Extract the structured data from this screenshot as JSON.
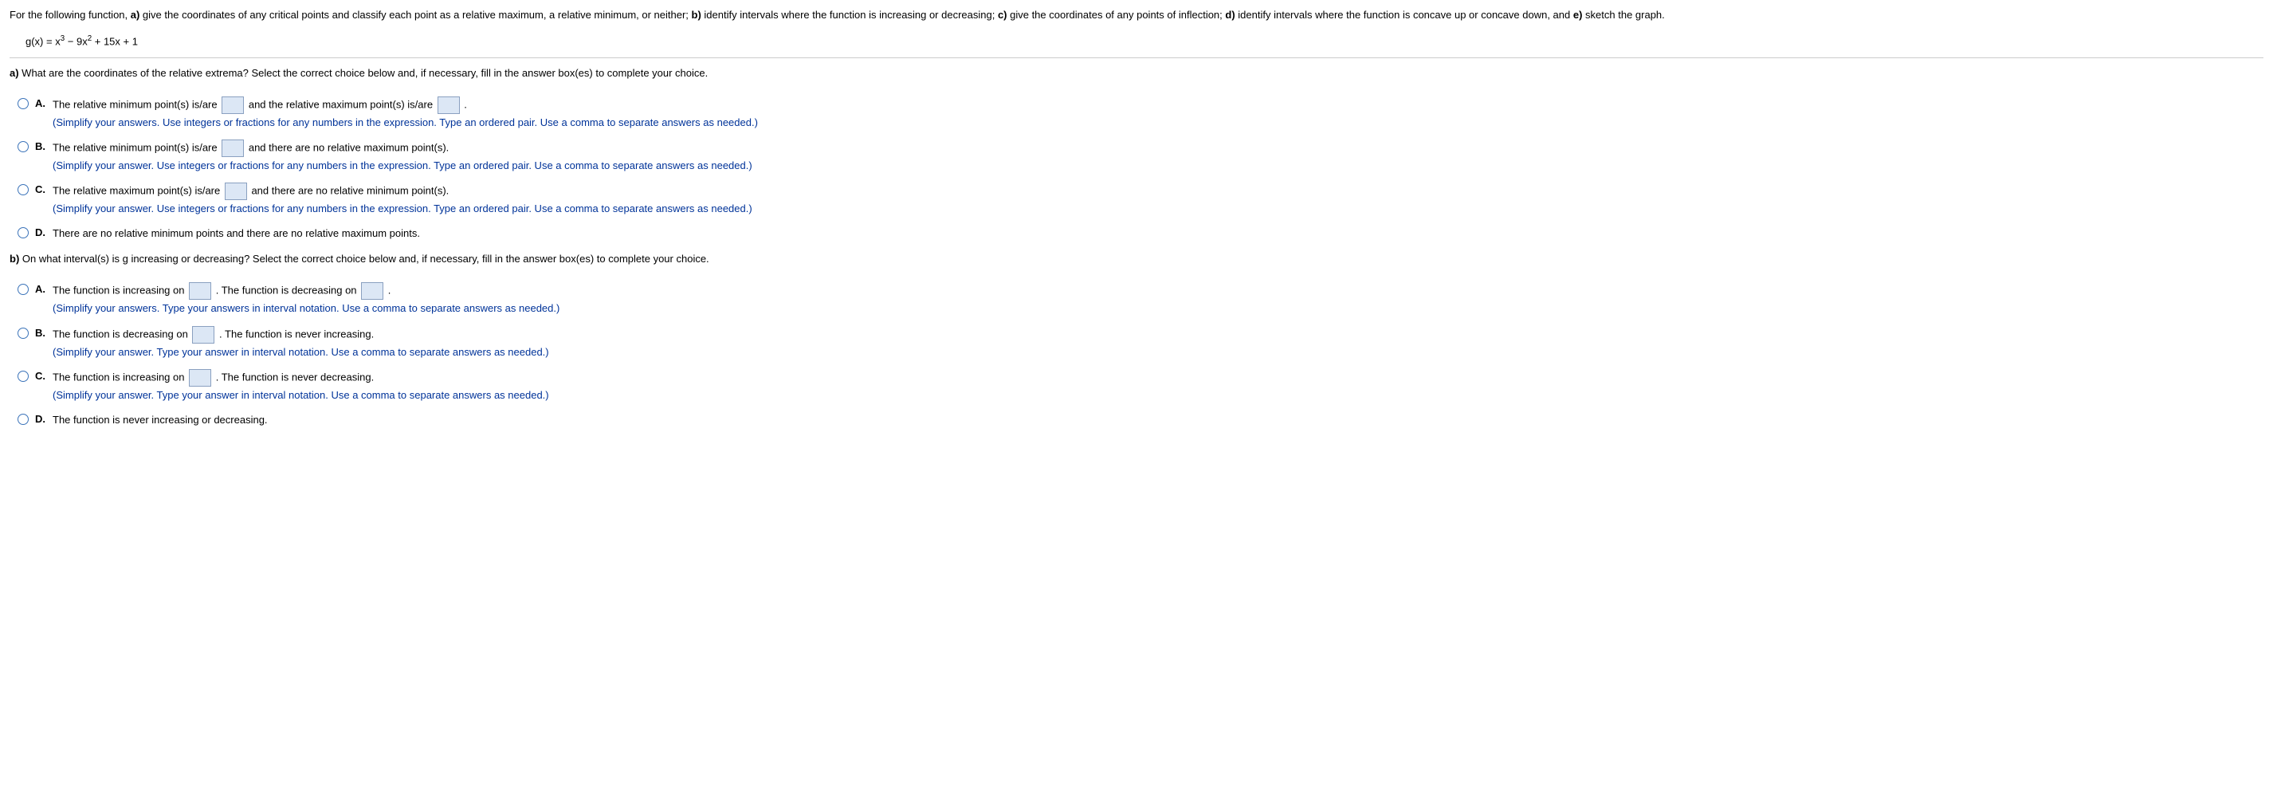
{
  "intro": {
    "prefix": "For the following function, ",
    "a_label": "a)",
    "a_text": " give the coordinates of any critical points and classify each point as a relative maximum, a relative minimum, or neither; ",
    "b_label": "b)",
    "b_text": " identify intervals where the function is increasing or decreasing; ",
    "c_label": "c)",
    "c_text": " give the coordinates of any points of inflection; ",
    "d_label": "d)",
    "d_text": " identify intervals where the function is concave up or concave down, and ",
    "e_label": "e)",
    "e_text": " sketch the graph."
  },
  "function_text": "g(x) = x³ − 9x² + 15x + 1",
  "part_a": {
    "label": "a)",
    "question": " What are the coordinates of the relative extrema? Select the correct choice below and, if necessary, fill in the answer box(es) to complete your choice."
  },
  "choices_a": {
    "A": {
      "letter": "A.",
      "t1": "The relative minimum point(s) is/are ",
      "t2": " and the relative maximum point(s) is/are ",
      "t3": " .",
      "hint": "(Simplify your answers. Use integers or fractions for any numbers in the expression. Type an ordered pair. Use a comma to separate answers as needed.)"
    },
    "B": {
      "letter": "B.",
      "t1": "The relative minimum point(s) is/are ",
      "t2": " and there are no relative maximum point(s).",
      "hint": "(Simplify your answer. Use integers or fractions for any numbers in the expression. Type an ordered pair. Use a comma to separate answers as needed.)"
    },
    "C": {
      "letter": "C.",
      "t1": "The relative maximum point(s) is/are ",
      "t2": " and there are no relative minimum point(s).",
      "hint": "(Simplify your answer. Use integers or fractions for any numbers in the expression. Type an ordered pair. Use a comma to separate answers as needed.)"
    },
    "D": {
      "letter": "D.",
      "text": "There are no relative minimum points and there are no relative maximum points."
    }
  },
  "part_b": {
    "label": "b)",
    "question": " On what interval(s) is g increasing or decreasing? Select the correct choice below and, if necessary, fill in the answer box(es) to complete your choice."
  },
  "choices_b": {
    "A": {
      "letter": "A.",
      "t1": "The function is increasing on ",
      "t2": " . The function is decreasing on ",
      "t3": " .",
      "hint": "(Simplify your answers. Type your answers in interval notation. Use a comma to separate answers as needed.)"
    },
    "B": {
      "letter": "B.",
      "t1": "The function is decreasing on ",
      "t2": " . The function is never increasing.",
      "hint": "(Simplify your answer. Type your answer in interval notation. Use a comma to separate answers as needed.)"
    },
    "C": {
      "letter": "C.",
      "t1": "The function is increasing on ",
      "t2": " . The function is never decreasing.",
      "hint": "(Simplify your answer. Type your answer in interval notation. Use a comma to separate answers as needed.)"
    },
    "D": {
      "letter": "D.",
      "text": "The function is never increasing or decreasing."
    }
  }
}
